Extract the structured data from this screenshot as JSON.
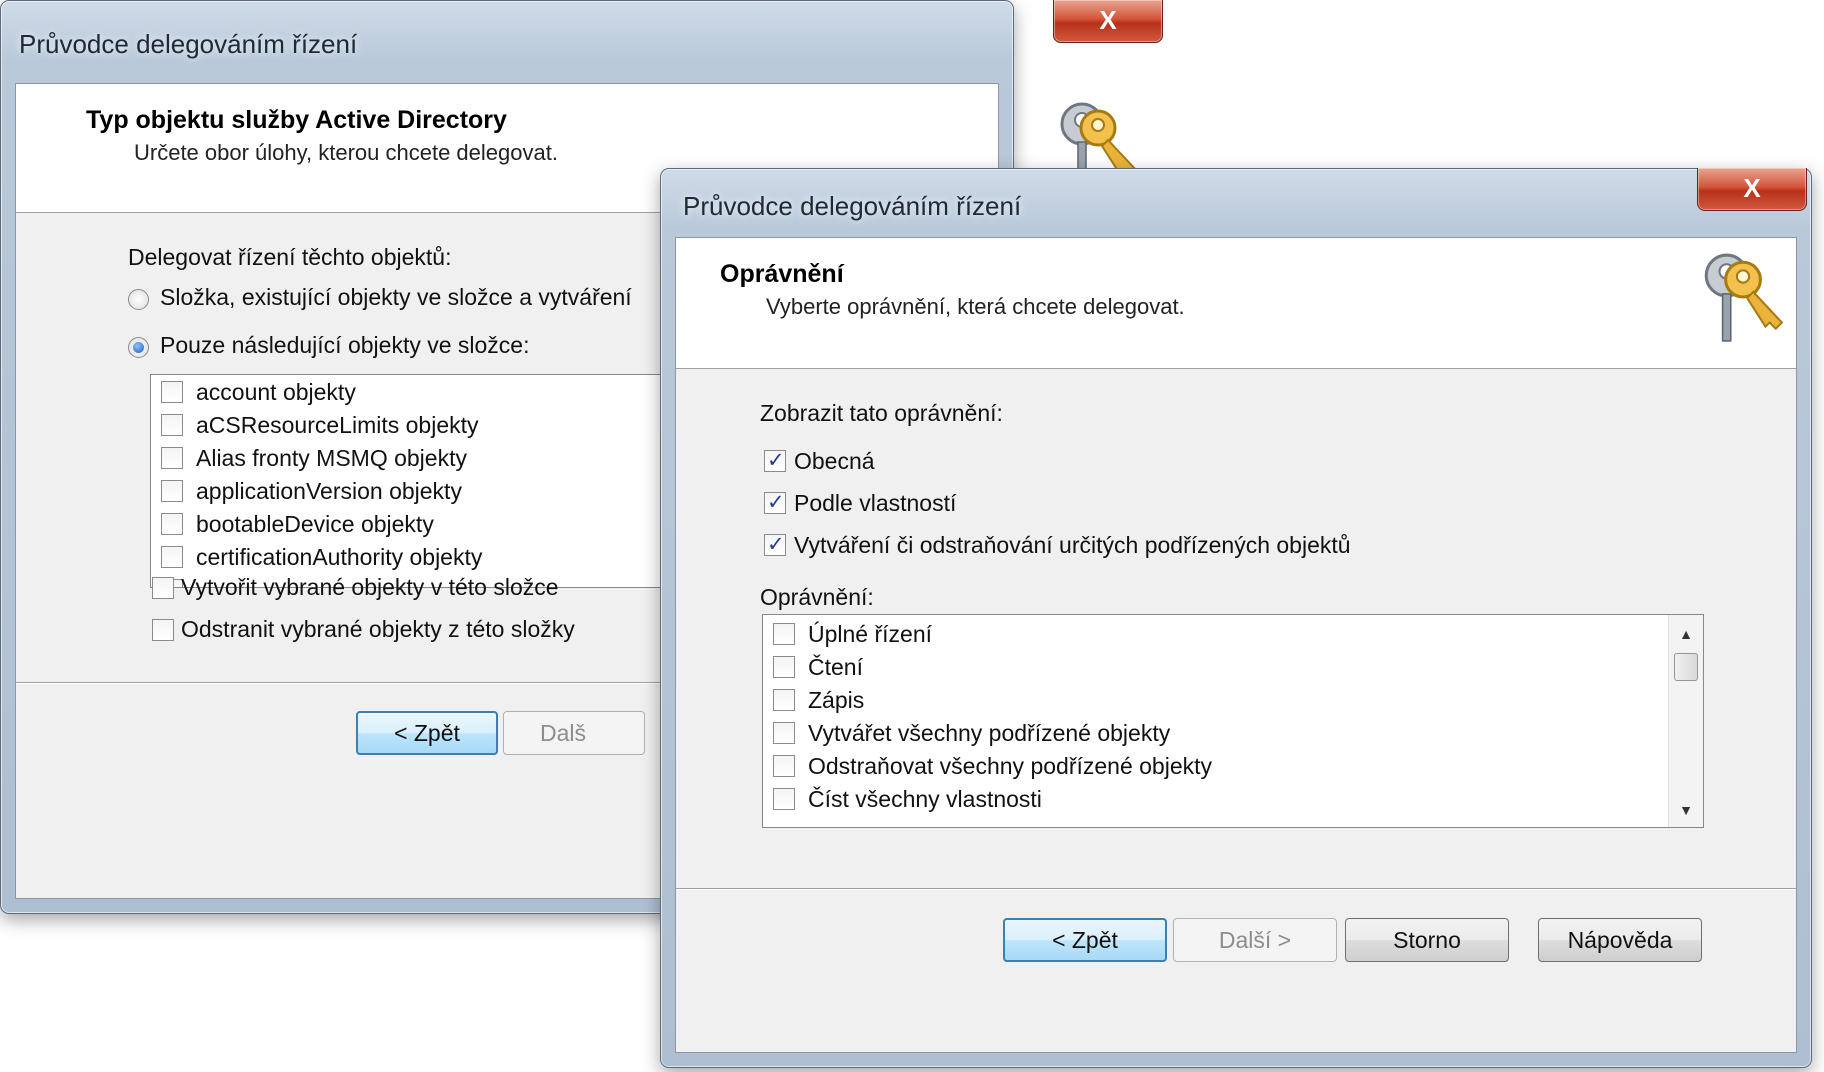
{
  "back_dialog": {
    "title": "Průvodce delegováním řízení",
    "header_title": "Typ objektu služby Active Directory",
    "header_subtitle": "Určete obor úlohy, kterou chcete delegovat.",
    "delegate_label": "Delegovat řízení těchto objektů:",
    "radio_folder": "Složka, existující objekty ve složce a vytváření",
    "radio_only": "Pouze následující objekty ve složce:",
    "objects": [
      "account objekty",
      "aCSResourceLimits objekty",
      "Alias fronty MSMQ objekty",
      "applicationVersion objekty",
      "bootableDevice objekty",
      "certificationAuthority objekty"
    ],
    "create_checkbox": "Vytvořit vybrané objekty v této složce",
    "delete_checkbox": "Odstranit vybrané objekty z této složky",
    "back_button": "< Zpět",
    "next_button_partial": "Dalš"
  },
  "front_dialog": {
    "title": "Průvodce delegováním řízení",
    "header_title": "Oprávnění",
    "header_subtitle": "Vyberte oprávnění, která chcete delegovat.",
    "show_label": "Zobrazit tato oprávnění:",
    "show_options": [
      {
        "label": "Obecná",
        "checked": true
      },
      {
        "label": "Podle vlastností",
        "checked": true
      },
      {
        "label": "Vytváření či odstraňování určitých podřízených objektů",
        "checked": true
      }
    ],
    "permissions_label": "Oprávnění:",
    "permissions": [
      "Úplné řízení",
      "Čtení",
      "Zápis",
      "Vytvářet všechny podřízené objekty",
      "Odstraňovat všechny podřízené objekty",
      "Číst všechny vlastnosti"
    ],
    "back_button": "< Zpět",
    "next_button": "Další >",
    "cancel_button": "Storno",
    "help_button": "Nápověda"
  },
  "icons": {
    "close": "close-icon",
    "keys": "keys-icon"
  }
}
